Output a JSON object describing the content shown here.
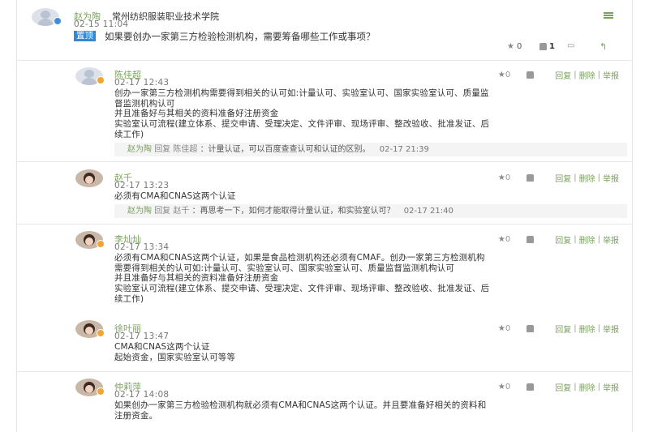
{
  "post": {
    "author": "赵为陶",
    "school": "常州纺织服装职业技术学院",
    "time": "02-15 11:04",
    "pin_label": "置顶",
    "title": "如果要创办一家第三方检验检测机构，需要筹备哪些工作或事项？",
    "star_count": "0",
    "like_count": "1"
  },
  "labels": {
    "reply": "回复",
    "delete": "删除",
    "report": "举报",
    "sep": "|",
    "reply_word": "回复"
  },
  "replies": [
    {
      "author": "陈佳超",
      "time": "02-17 12:43",
      "star_count": "0",
      "lines": [
        "创办一家第三方检测机构需要得到相关的认可如:计量认可、实验室认可、国家实验室认可、质量监",
        "督监测机构认可",
        "并且准备好与其相关的资料准备好注册资金",
        "实验室认可流程(建立体系、提交申请、受理决定、文件评审、现场评审、整改验收、批准发证、后",
        "续工作)"
      ],
      "sub": {
        "from": "赵为陶",
        "to": "陈佳超",
        "text": "：计量认证，可以百度查查认可和认证的区别。",
        "time": "02-17 21:39"
      }
    },
    {
      "author": "赵千",
      "time": "02-17 13:23",
      "star_count": "0",
      "lines": [
        "必须有CMA和CNAS这两个认证"
      ],
      "sub": {
        "from": "赵为陶",
        "to": "赵千",
        "text": "：再思考一下，如何才能取得计量认证，和实验室认可？",
        "time": "02-17 21:40"
      }
    },
    {
      "author": "李灿灿",
      "time": "02-17 13:34",
      "star_count": "0",
      "lines": [
        "必须有CMA和CNAS这两个认证，如果是食品检测机构还必须有CMAF。创办一家第三方检测机构",
        "需要得到相关的认可如:计量认可、实验室认可、国家实验室认可、质量监督监测机构认可",
        "并且准备好与其相关的资料准备好注册资金",
        "实验室认可流程(建立体系、提交申请、受理决定、文件评审、现场评审、整改验收、批准发证、后",
        "续工作)"
      ]
    },
    {
      "author": "徐叶丽",
      "time": "02-17 13:47",
      "star_count": "0",
      "lines": [
        "CMA和CNAS这两个认证",
        "起始资金，国家实验室认可等等"
      ]
    },
    {
      "author": "仲莉萍",
      "time": "02-17 14:08",
      "star_count": "0",
      "lines": [
        "如果创办一家第三方检验检测机构就必须有CMA和CNAS这两个认证。并且要准备好相关的资料和",
        "注册资金。"
      ]
    }
  ],
  "colors": {
    "accent_green": "#7aa25d",
    "pin_blue": "#2e8ad8"
  },
  "icons": [
    "star-icon",
    "thumb-up-icon",
    "comment-icon",
    "menu-icon",
    "share-arrow-icon"
  ]
}
